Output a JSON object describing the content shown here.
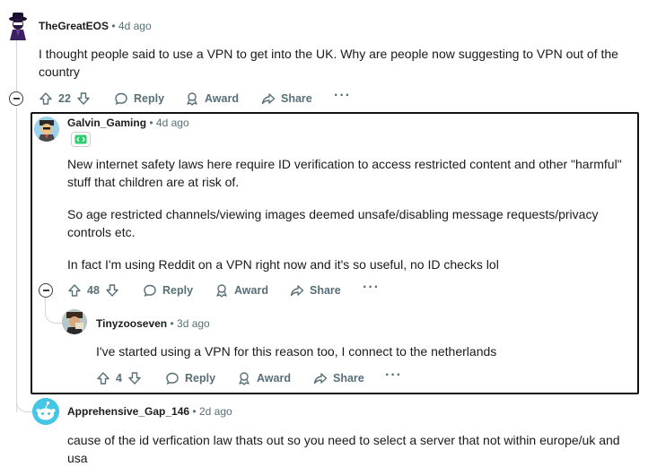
{
  "comments": {
    "c1": {
      "author": "TheGreatEOS",
      "time": "• 4d ago",
      "body": "I thought people said to use a VPN to get into the UK. Why are people now suggesting to VPN out of the country",
      "votes": "22"
    },
    "c2": {
      "author": "Galvin_Gaming",
      "time": "• 4d ago",
      "paragraphs": [
        "New internet safety laws here require ID verification to access restricted content and other \"harmful\" stuff that children are at risk of.",
        "So age restricted channels/viewing images deemed unsafe/disabling message requests/privacy controls etc.",
        "In fact I'm using Reddit on a VPN right now and it's so useful, no ID checks lol"
      ],
      "votes": "48"
    },
    "c3": {
      "author": "Tinyzooseven",
      "time": "• 3d ago",
      "body": "I've started using a VPN for this reason too, I connect to the netherlands",
      "votes": "4"
    },
    "c4": {
      "author": "Apprehensive_Gap_146",
      "time": "• 2d ago",
      "body": "cause of the id verfication law thats out so you need to select a server that not within europe/uk and usa"
    }
  },
  "actions": {
    "reply": "Reply",
    "award": "Award",
    "share": "Share",
    "more": "···"
  },
  "icons": [
    "upvote-icon",
    "downvote-icon",
    "reply-icon",
    "award-icon",
    "share-icon",
    "collapse-icon",
    "badge-icon"
  ],
  "colors": {
    "meta": "#576f76",
    "thread_line": "#d3d6da",
    "badge_green": "#2ecc71"
  }
}
